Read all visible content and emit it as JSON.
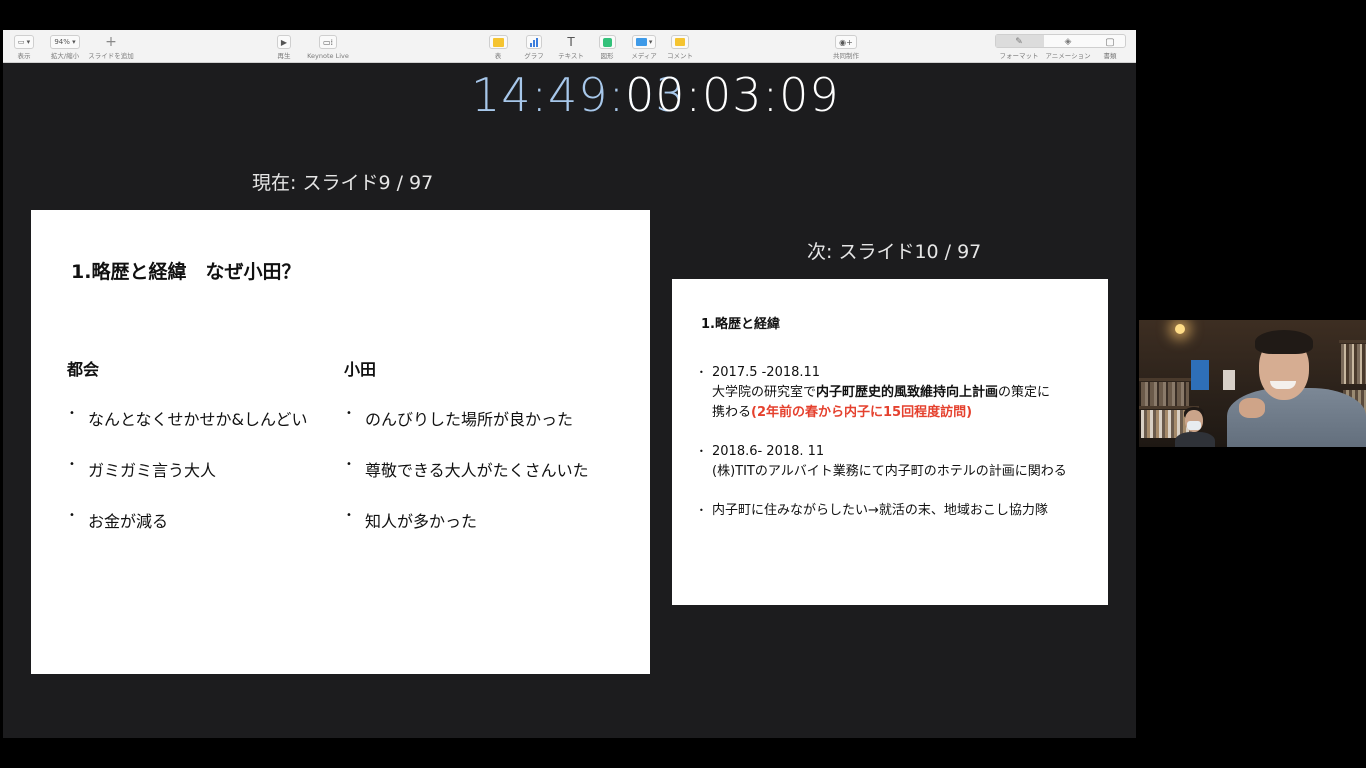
{
  "toolbar": {
    "items": [
      {
        "label": "表示",
        "icon": "sidebar-view-icon"
      },
      {
        "label": "拡大/縮小",
        "value": "94%",
        "icon": "zoom-icon"
      },
      {
        "label": "スライドを追加",
        "icon": "plus-icon"
      },
      {
        "label": "再生",
        "icon": "play-icon"
      },
      {
        "label": "Keynote Live",
        "icon": "keynote-live-icon"
      },
      {
        "label": "表",
        "icon": "table-icon",
        "color": "#f5c431"
      },
      {
        "label": "グラフ",
        "icon": "chart-icon",
        "color": "#3b7ddd"
      },
      {
        "label": "テキスト",
        "icon": "text-icon"
      },
      {
        "label": "図形",
        "icon": "shape-icon",
        "color": "#33c17a"
      },
      {
        "label": "メディア",
        "icon": "media-icon",
        "color": "#3e9ae8"
      },
      {
        "label": "コメント",
        "icon": "comment-icon",
        "color": "#f5c431"
      },
      {
        "label": "共同制作",
        "icon": "collaborate-icon"
      },
      {
        "label": "フォーマット",
        "icon": "format-brush-icon"
      },
      {
        "label": "アニメーション",
        "icon": "animation-icon"
      },
      {
        "label": "書類",
        "icon": "document-icon"
      }
    ]
  },
  "clock": {
    "time": "14:49:03",
    "elapsed": "00:03:09"
  },
  "current": {
    "label": "現在: スライド9 / 97",
    "slide": {
      "title": "1.略歴と経緯　なぜ小田？",
      "left_heading": "都会",
      "left_bullets": [
        "なんとなくせかせか&しんどい",
        "ガミガミ言う大人",
        "お金が減る"
      ],
      "right_heading": "小田",
      "right_bullets": [
        "のんびりした場所が良かった",
        "尊敬できる大人がたくさんいた",
        "知人が多かった"
      ]
    }
  },
  "next": {
    "label": "次: スライド10 / 97",
    "slide": {
      "title": "1.略歴と経緯",
      "b1_line1": "2017.5 -2018.11",
      "b1_line2_pre": "大学院の研究室で",
      "b1_line2_bold": "内子町歴史的風致維持向上計画",
      "b1_line2_post": "の策定に",
      "b1_line3_pre": "携わる",
      "b1_line3_red": "(2年前の春から内子に15回程度訪問)",
      "b2_line1": "2018.6- 2018. 11",
      "b2_line2": "(株)TITのアルバイト業務にて内子町のホテルの計画に関わる",
      "b3": "内子町に住みながらしたい→就活の末、地域おこし協力隊"
    }
  }
}
